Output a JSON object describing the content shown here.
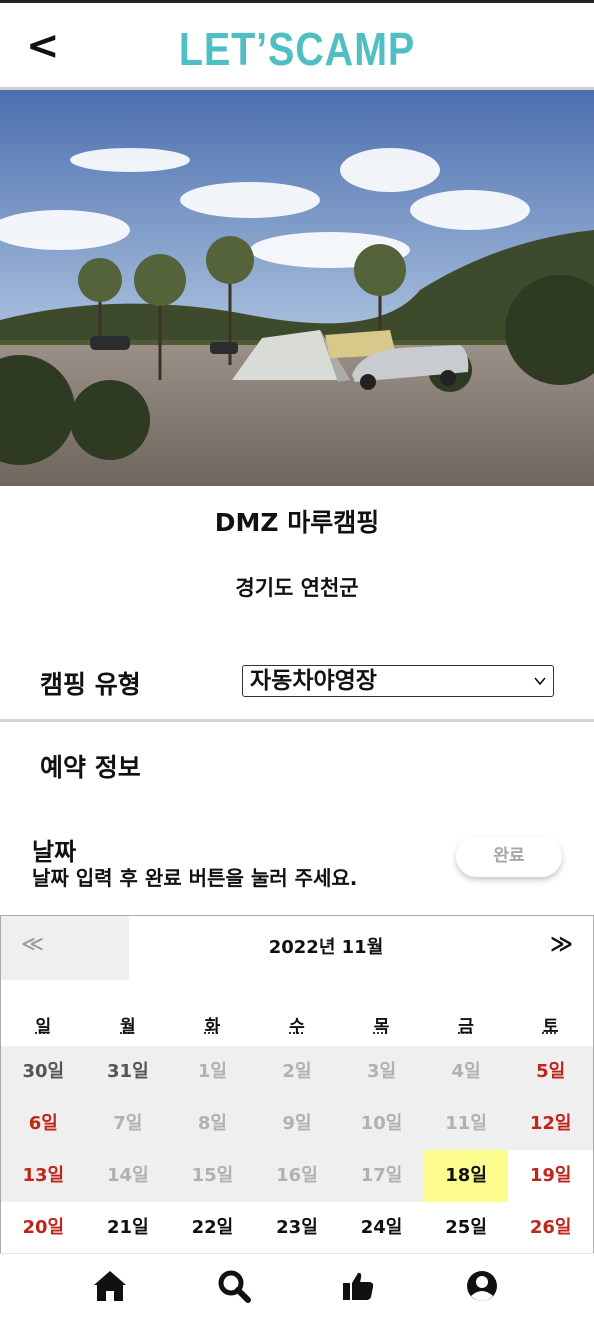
{
  "header": {
    "back_symbol": "<",
    "brand": "LET’SCAMP"
  },
  "campsite": {
    "name": "DMZ 마루캠핑",
    "region": "경기도 연천군"
  },
  "camping_type": {
    "label": "캠핑 유형",
    "selected": "자동차야영장"
  },
  "reservation": {
    "title": "예약 정보"
  },
  "date_section": {
    "title": "날짜",
    "hint": "날짜 입력 후 완료 버튼을 눌러 주세요.",
    "done_label": "완료"
  },
  "calendar": {
    "prev_symbol": "≪",
    "next_symbol": "≫",
    "month_label": "2022년 11월",
    "weekdays": [
      "일",
      "월",
      "화",
      "수",
      "목",
      "금",
      "토"
    ],
    "weeks": [
      [
        {
          "label": "30일",
          "state": "past-month"
        },
        {
          "label": "31일",
          "state": "past-month"
        },
        {
          "label": "1일",
          "state": "disabled"
        },
        {
          "label": "2일",
          "state": "disabled"
        },
        {
          "label": "3일",
          "state": "disabled"
        },
        {
          "label": "4일",
          "state": "disabled"
        },
        {
          "label": "5일",
          "state": "weekend-disabled"
        }
      ],
      [
        {
          "label": "6일",
          "state": "weekend-disabled"
        },
        {
          "label": "7일",
          "state": "disabled"
        },
        {
          "label": "8일",
          "state": "disabled"
        },
        {
          "label": "9일",
          "state": "disabled"
        },
        {
          "label": "10일",
          "state": "disabled"
        },
        {
          "label": "11일",
          "state": "disabled"
        },
        {
          "label": "12일",
          "state": "weekend-disabled"
        }
      ],
      [
        {
          "label": "13일",
          "state": "weekend-disabled"
        },
        {
          "label": "14일",
          "state": "disabled"
        },
        {
          "label": "15일",
          "state": "disabled"
        },
        {
          "label": "16일",
          "state": "disabled"
        },
        {
          "label": "17일",
          "state": "disabled"
        },
        {
          "label": "18일",
          "state": "selected"
        },
        {
          "label": "19일",
          "state": "weekend"
        }
      ],
      [
        {
          "label": "20일",
          "state": "weekend"
        },
        {
          "label": "21일",
          "state": "available"
        },
        {
          "label": "22일",
          "state": "available"
        },
        {
          "label": "23일",
          "state": "available"
        },
        {
          "label": "24일",
          "state": "available"
        },
        {
          "label": "25일",
          "state": "available"
        },
        {
          "label": "26일",
          "state": "weekend"
        }
      ]
    ]
  },
  "bottom_nav": [
    {
      "name": "nav-home",
      "icon": "home-icon"
    },
    {
      "name": "nav-search",
      "icon": "search-icon"
    },
    {
      "name": "nav-like",
      "icon": "thumbs-up-icon"
    },
    {
      "name": "nav-profile",
      "icon": "user-icon"
    }
  ],
  "colors": {
    "brand": "#4fbfc4",
    "weekend": "#c0251b",
    "selected": "#fdfd8f",
    "disabled": "#b1b1b1"
  }
}
